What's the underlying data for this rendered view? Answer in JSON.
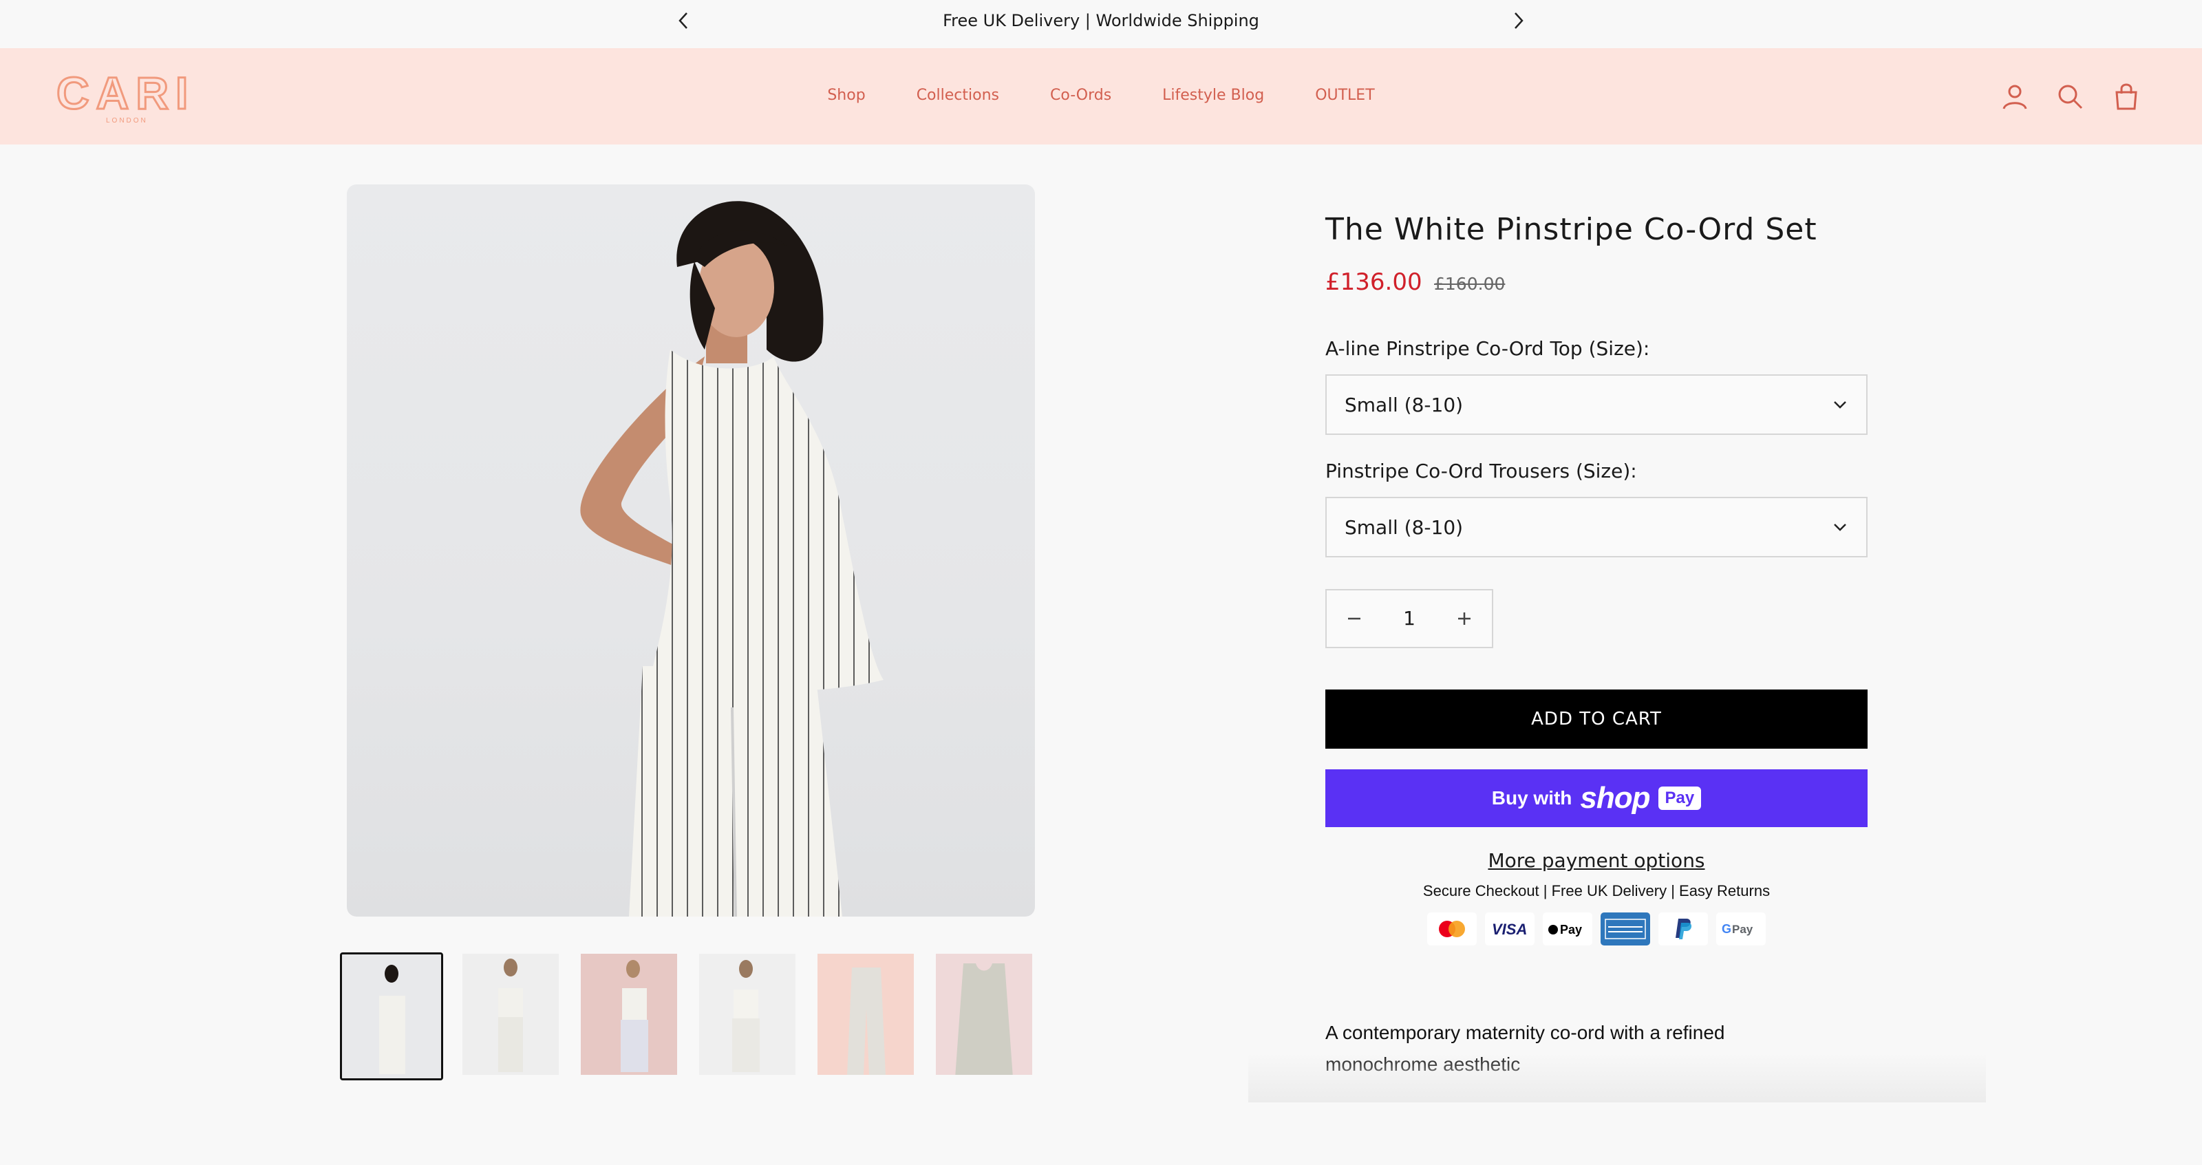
{
  "announcement": {
    "text": "Free UK Delivery | Worldwide Shipping"
  },
  "brand": {
    "name": "CARI",
    "sub": "LONDON"
  },
  "nav": [
    {
      "label": "Shop"
    },
    {
      "label": "Collections"
    },
    {
      "label": "Co-Ords"
    },
    {
      "label": "Lifestyle Blog"
    },
    {
      "label": "OUTLET"
    }
  ],
  "product": {
    "title": "The White Pinstripe Co-Ord Set",
    "price": "£136.00",
    "compare_price": "£160.00",
    "option1": {
      "label": "A-line Pinstripe Co-Ord Top (Size):",
      "value": "Small (8-10)"
    },
    "option2": {
      "label": "Pinstripe Co-Ord Trousers (Size):",
      "value": "Small (8-10)"
    },
    "quantity": "1",
    "add_to_cart": "ADD TO CART",
    "shop_pay": {
      "buy": "Buy with",
      "shop": "shop",
      "pay": "Pay"
    },
    "more_payment": "More payment options",
    "secure_text": "Secure Checkout | Free UK Delivery | Easy Returns",
    "payment_icons": [
      "mastercard-icon",
      "visa-icon",
      "apple-pay-icon",
      "amex-icon",
      "paypal-icon",
      "google-pay-icon"
    ],
    "description": "A contemporary maternity co-ord with a refined monochrome aesthetic"
  },
  "colors": {
    "accent": "#d25f4f",
    "header_bg": "#fde4de",
    "sale": "#d0202a",
    "shop_pay": "#5a31f4"
  }
}
